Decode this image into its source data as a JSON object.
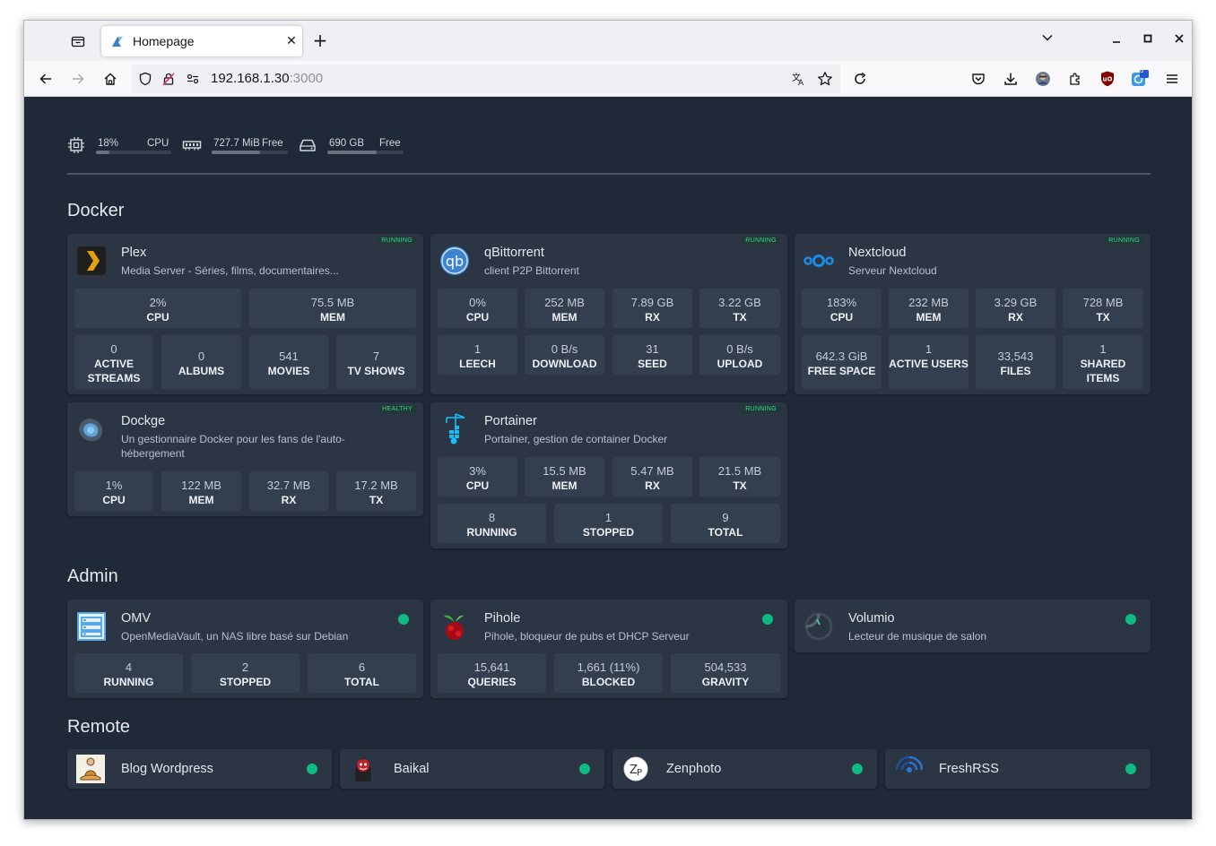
{
  "browser": {
    "tab_title": "Homepage",
    "new_tab_label": "+",
    "close_tab_label": "✕",
    "url_host": "192.168.1.30",
    "url_port": ":3000",
    "extension_badge": "5"
  },
  "resources": {
    "cpu": {
      "value": "18%",
      "label": "CPU",
      "level": 0.18
    },
    "memory": {
      "value": "727.7 MiB",
      "label": "Free",
      "level": 0.64
    },
    "disk": {
      "value": "690 GB",
      "label": "Free",
      "level": 0.65
    }
  },
  "docker": {
    "title": "Docker",
    "plex": {
      "name": "Plex",
      "desc": "Media Server - Séries, films, documentaires...",
      "status": "RUNNING",
      "stats": [
        {
          "value": "2%",
          "label": "CPU"
        },
        {
          "value": "75.5 MB",
          "label": "MEM"
        },
        {
          "value": "0",
          "label": "ACTIVE STREAMS"
        },
        {
          "value": "0",
          "label": "ALBUMS"
        },
        {
          "value": "541",
          "label": "MOVIES"
        },
        {
          "value": "7",
          "label": "TV SHOWS"
        }
      ]
    },
    "qbittorrent": {
      "name": "qBittorrent",
      "desc": "client P2P Bittorrent",
      "status": "RUNNING",
      "stats": [
        {
          "value": "0%",
          "label": "CPU"
        },
        {
          "value": "252 MB",
          "label": "MEM"
        },
        {
          "value": "7.89 GB",
          "label": "RX"
        },
        {
          "value": "3.22 GB",
          "label": "TX"
        },
        {
          "value": "1",
          "label": "LEECH"
        },
        {
          "value": "0 B/s",
          "label": "DOWNLOAD"
        },
        {
          "value": "31",
          "label": "SEED"
        },
        {
          "value": "0 B/s",
          "label": "UPLOAD"
        }
      ]
    },
    "nextcloud": {
      "name": "Nextcloud",
      "desc": "Serveur Nextcloud",
      "status": "RUNNING",
      "stats": [
        {
          "value": "183%",
          "label": "CPU"
        },
        {
          "value": "232 MB",
          "label": "MEM"
        },
        {
          "value": "3.29 GB",
          "label": "RX"
        },
        {
          "value": "728 MB",
          "label": "TX"
        },
        {
          "value": "642.3 GiB",
          "label": "FREE SPACE"
        },
        {
          "value": "1",
          "label": "ACTIVE USERS"
        },
        {
          "value": "33,543",
          "label": "FILES"
        },
        {
          "value": "1",
          "label": "SHARED ITEMS"
        }
      ]
    },
    "dockge": {
      "name": "Dockge",
      "desc": "Un gestionnaire Docker pour les fans de l'auto-hébergement",
      "status": "HEALTHY",
      "stats": [
        {
          "value": "1%",
          "label": "CPU"
        },
        {
          "value": "122 MB",
          "label": "MEM"
        },
        {
          "value": "32.7 MB",
          "label": "RX"
        },
        {
          "value": "17.2 MB",
          "label": "TX"
        }
      ]
    },
    "portainer": {
      "name": "Portainer",
      "desc": "Portainer, gestion de container Docker",
      "status": "RUNNING",
      "stats": [
        {
          "value": "3%",
          "label": "CPU"
        },
        {
          "value": "15.5 MB",
          "label": "MEM"
        },
        {
          "value": "5.47 MB",
          "label": "RX"
        },
        {
          "value": "21.5 MB",
          "label": "TX"
        },
        {
          "value": "8",
          "label": "RUNNING"
        },
        {
          "value": "1",
          "label": "STOPPED"
        },
        {
          "value": "9",
          "label": "TOTAL"
        }
      ]
    }
  },
  "admin": {
    "title": "Admin",
    "omv": {
      "name": "OMV",
      "desc": "OpenMediaVault, un NAS libre basé sur Debian",
      "stats": [
        {
          "value": "4",
          "label": "RUNNING"
        },
        {
          "value": "2",
          "label": "STOPPED"
        },
        {
          "value": "6",
          "label": "TOTAL"
        }
      ]
    },
    "pihole": {
      "name": "Pihole",
      "desc": "Pihole, bloqueur de pubs et DHCP Serveur",
      "stats": [
        {
          "value": "15,641",
          "label": "QUERIES"
        },
        {
          "value": "1,661 (11%)",
          "label": "BLOCKED"
        },
        {
          "value": "504,533",
          "label": "GRAVITY"
        }
      ]
    },
    "volumio": {
      "name": "Volumio",
      "desc": "Lecteur de musique de salon"
    }
  },
  "remote": {
    "title": "Remote",
    "items": [
      {
        "name": "Blog Wordpress"
      },
      {
        "name": "Baikal"
      },
      {
        "name": "Zenphoto"
      },
      {
        "name": "FreshRSS"
      }
    ]
  },
  "colors": {
    "background": "#1f2937",
    "card": "#2b3544",
    "status_green": "#10b981"
  }
}
